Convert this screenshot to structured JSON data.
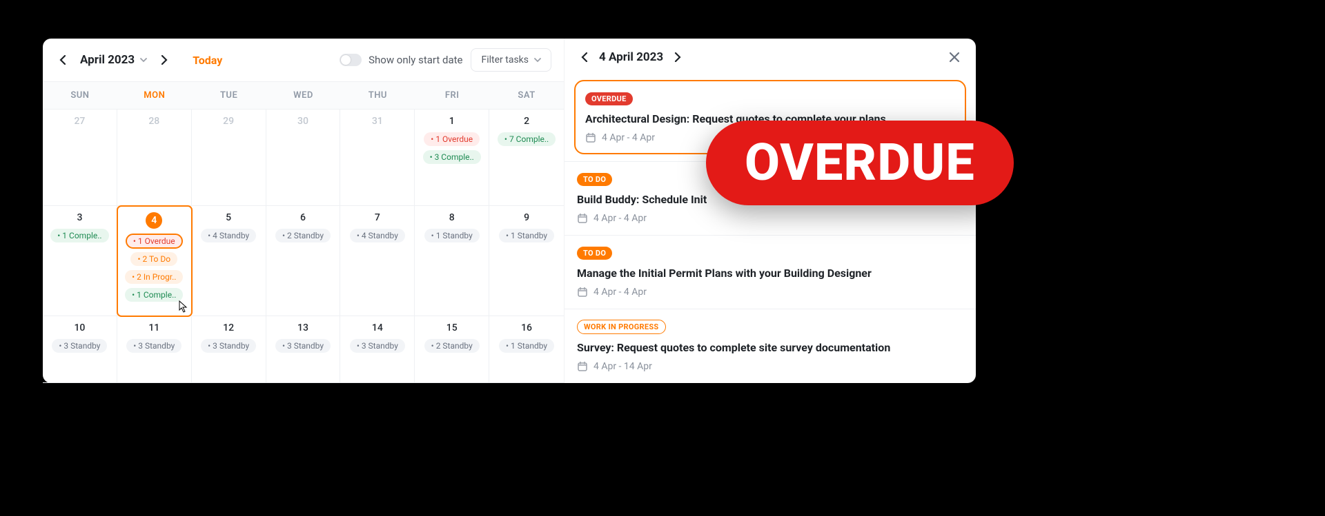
{
  "toolbar": {
    "month": "April 2023",
    "today": "Today",
    "toggle_label": "Show only start date",
    "filter_label": "Filter tasks"
  },
  "weekdays": [
    "SUN",
    "MON",
    "TUE",
    "WED",
    "THU",
    "FRI",
    "SAT"
  ],
  "active_weekday": 1,
  "rows": [
    [
      {
        "n": "27",
        "faded": true,
        "pills": []
      },
      {
        "n": "28",
        "faded": true,
        "pills": []
      },
      {
        "n": "29",
        "faded": true,
        "pills": []
      },
      {
        "n": "30",
        "faded": true,
        "pills": []
      },
      {
        "n": "31",
        "faded": true,
        "pills": []
      },
      {
        "n": "1",
        "pills": [
          {
            "t": "• 1 Overdue",
            "k": "red"
          },
          {
            "t": "• 3 Comple..",
            "k": "green"
          }
        ]
      },
      {
        "n": "2",
        "pills": [
          {
            "t": "• 7 Comple..",
            "k": "green"
          }
        ]
      }
    ],
    [
      {
        "n": "3",
        "pills": [
          {
            "t": "• 1 Comple..",
            "k": "green"
          }
        ]
      },
      {
        "n": "4",
        "selected": true,
        "circle": true,
        "pills": [
          {
            "t": "• 1 Overdue",
            "k": "red",
            "hl": true
          },
          {
            "t": "• 2 To Do",
            "k": "orange"
          },
          {
            "t": "• 2 In Progr..",
            "k": "orange"
          },
          {
            "t": "• 1 Comple..",
            "k": "green"
          }
        ],
        "cursor": true
      },
      {
        "n": "5",
        "pills": [
          {
            "t": "• 4 Standby",
            "k": "grey"
          }
        ]
      },
      {
        "n": "6",
        "pills": [
          {
            "t": "• 2 Standby",
            "k": "grey"
          }
        ]
      },
      {
        "n": "7",
        "pills": [
          {
            "t": "• 4 Standby",
            "k": "grey"
          }
        ]
      },
      {
        "n": "8",
        "pills": [
          {
            "t": "• 1 Standby",
            "k": "grey"
          }
        ]
      },
      {
        "n": "9",
        "pills": [
          {
            "t": "• 1 Standby",
            "k": "grey"
          }
        ]
      }
    ],
    [
      {
        "n": "10",
        "pills": [
          {
            "t": "• 3 Standby",
            "k": "grey"
          }
        ]
      },
      {
        "n": "11",
        "pills": [
          {
            "t": "• 3 Standby",
            "k": "grey"
          }
        ]
      },
      {
        "n": "12",
        "pills": [
          {
            "t": "• 3 Standby",
            "k": "grey"
          }
        ]
      },
      {
        "n": "13",
        "pills": [
          {
            "t": "• 3 Standby",
            "k": "grey"
          }
        ]
      },
      {
        "n": "14",
        "pills": [
          {
            "t": "• 3 Standby",
            "k": "grey"
          }
        ]
      },
      {
        "n": "15",
        "pills": [
          {
            "t": "• 2 Standby",
            "k": "grey"
          }
        ]
      },
      {
        "n": "16",
        "pills": [
          {
            "t": "• 1 Standby",
            "k": "grey"
          }
        ]
      }
    ]
  ],
  "detail": {
    "date": "4 April 2023",
    "tasks": [
      {
        "status": "OVERDUE",
        "status_k": "overdue",
        "title": "Architectural Design: Request quotes to complete your plans",
        "dates": "4 Apr - 4 Apr",
        "sel": true
      },
      {
        "status": "TO DO",
        "status_k": "todo",
        "title": "Build Buddy: Schedule Init",
        "dates": "4 Apr - 4 Apr"
      },
      {
        "status": "TO DO",
        "status_k": "todo",
        "title": "Manage the Initial Permit Plans with your Building Designer",
        "dates": "4 Apr - 4 Apr"
      },
      {
        "status": "WORK IN PROGRESS",
        "status_k": "wip",
        "title": "Survey: Request quotes to complete site survey documentation",
        "dates": "4 Apr - 14 Apr"
      }
    ]
  },
  "overlay": "OVERDUE"
}
